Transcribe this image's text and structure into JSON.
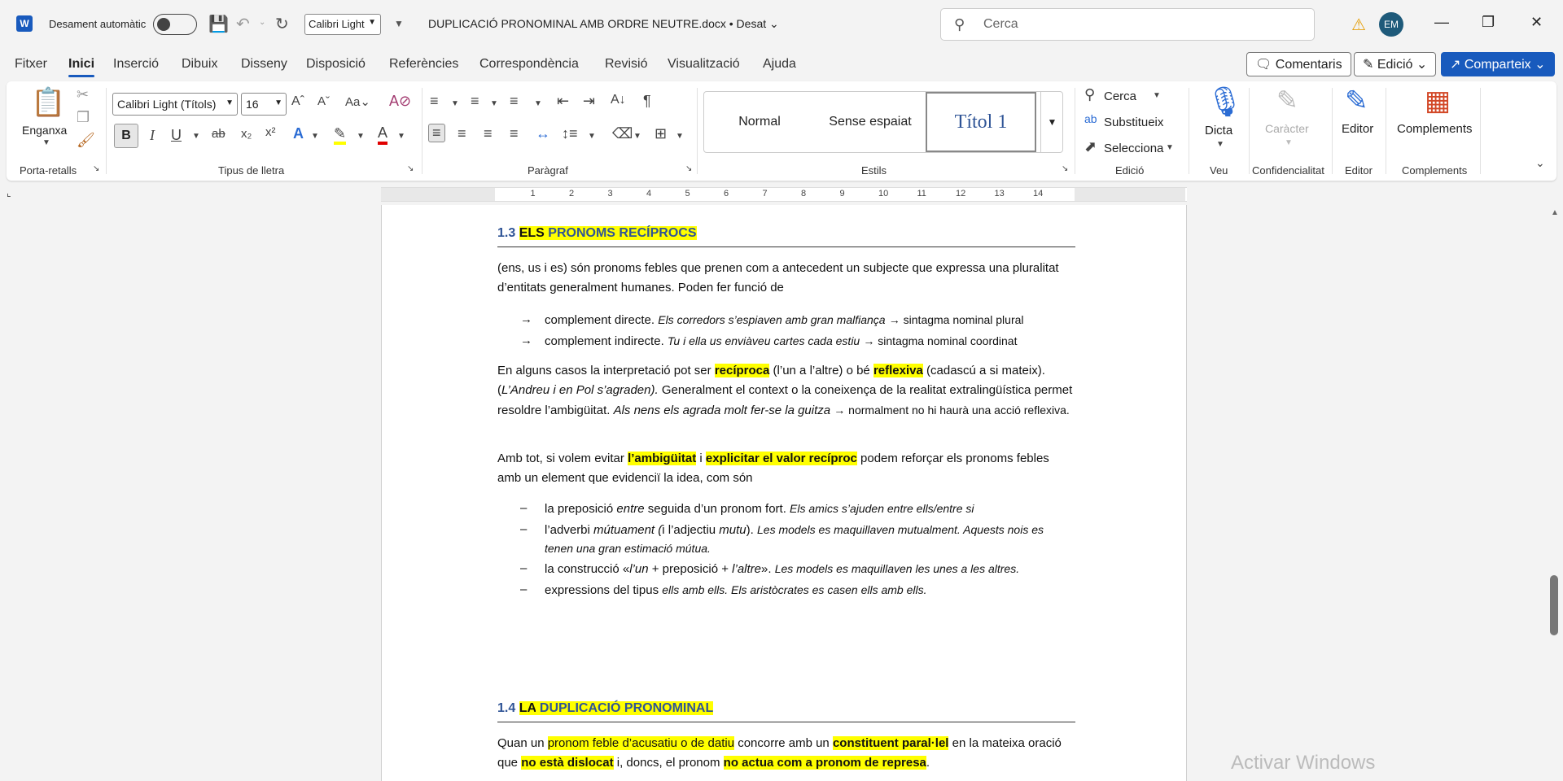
{
  "titlebar": {
    "autosave_label": "Desament automàtic",
    "font_quick": "Calibri Light",
    "doc_title": "DUPLICACIÓ PRONOMINAL AMB ORDRE NEUTRE.docx • Desat ⌄",
    "search_placeholder": "Cerca",
    "avatar": "EM"
  },
  "tabs": [
    "Fitxer",
    "Inici",
    "Inserció",
    "Dibuix",
    "Disseny",
    "Disposició",
    "Referències",
    "Correspondència",
    "Revisió",
    "Visualització",
    "Ajuda"
  ],
  "ribbon_right": {
    "comments": "Comentaris",
    "editing": "Edició",
    "share": "Comparteix"
  },
  "ribbon": {
    "paste": "Enganxa",
    "font_name": "Calibri Light (Títols)",
    "font_size": "16",
    "styles": [
      "Normal",
      "Sense espaiat",
      "Títol 1"
    ],
    "find": "Cerca",
    "replace": "Substitueix",
    "select": "Selecciona",
    "dictate": "Dicta",
    "sensitivity": "Caràcter",
    "editor": "Editor",
    "addins": "Complements",
    "groups": {
      "clipboard": "Porta-retalls",
      "font": "Tipus de lletra",
      "paragraph": "Paràgraf",
      "styles": "Estils",
      "editing": "Edició",
      "voice": "Veu",
      "sensitivity": "Confidencialitat",
      "editor": "Editor",
      "addins": "Complements"
    }
  },
  "ruler": {
    "numbers": [
      "1",
      "2",
      "3",
      "4",
      "5",
      "6",
      "7",
      "8",
      "9",
      "10",
      "11",
      "12",
      "13",
      "14"
    ]
  },
  "doc": {
    "h13_num": "1.3",
    "h13_word1": "ELS",
    "h13_rest": "PRONOMS RECÍPROCS",
    "p1": "(ens, us i es) són pronoms febles que prenen com a antecedent un subjecte que expressa una pluralitat d’entitats generalment humanes. Poden fer funció de",
    "b1_mark": "→",
    "b1_a": "complement directe.",
    "b1_b": "Els corredors s’espiaven amb gran malfiança",
    "b1_c": "→ sintagma nominal plural",
    "b2_mark": "→",
    "b2_a": "complement indirecte.",
    "b2_b": "Tu i ella us enviàveu cartes cada estiu",
    "b2_c": "→ sintagma nominal coordinat",
    "p2_a": "En alguns casos la interpretació pot ser",
    "p2_b": "recíproca",
    "p2_c": "(l’un a l’altre) o bé",
    "p2_d": "reflexiva",
    "p2_e": "(cadascú a si mateix). (",
    "p2_f": "L’Andreu i en Pol s’agraden).",
    "p2_g": "Generalment el context o la coneixença de la realitat extralingüística permet resoldre l’ambigüitat.",
    "p2_h": "Als nens els agrada molt fer-se la guitza",
    "p2_i": "→ normalment no hi haurà una acció reflexiva.",
    "p3_a": "Amb tot, si volem evitar",
    "p3_b": "l’ambigüitat",
    "p3_c": "i",
    "p3_d": "explicitar el valor recíproc",
    "p3_e": "podem reforçar els pronoms febles amb un element que evidenciï la idea, com són",
    "d_mark": "–",
    "d1_a": "la preposició",
    "d1_b": "entre",
    "d1_c": "seguida d’un pronom fort.",
    "d1_d": "Els amics s’ajuden entre ells/entre si",
    "d2_a": "l’adverbi",
    "d2_b": "mútuament (",
    "d2_c": "i l’adjectiu",
    "d2_d": "mutu",
    "d2_e": ").",
    "d2_f": "Les models es maquillaven mutualment. Aquests nois es tenen una gran estimació mútua.",
    "d3_a": "la construcció «",
    "d3_b": "l’un",
    "d3_c": "+ preposició +",
    "d3_d": "l’altre",
    "d3_e": "».",
    "d3_f": "Les models es maquillaven les unes a les altres.",
    "d4_a": "expressions del tipus",
    "d4_b": "ells amb ells. Els aristòcrates es casen ells amb ells.",
    "h14_num": "1.4",
    "h14_word1": "LA",
    "h14_rest": "DUPLICACIÓ PRONOMINAL",
    "p4_a": "Quan un",
    "p4_b": "pronom feble d’acusatiu o de datiu",
    "p4_c": "concorre amb un",
    "p4_d": "constituent paral·lel",
    "p4_e": "en la mateixa oració que",
    "p4_f": "no està dislocat",
    "p4_g": "i, doncs, el pronom",
    "p4_h": "no actua com a pronom de represa",
    "p4_i": "."
  },
  "watermark": "Activar Windows"
}
